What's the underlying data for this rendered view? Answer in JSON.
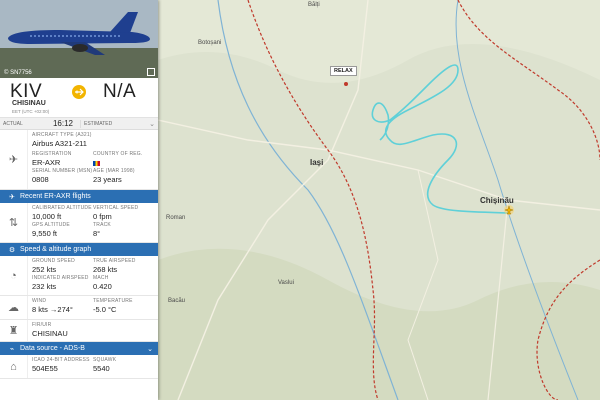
{
  "photo": {
    "credit": "© SN7756"
  },
  "route": {
    "from_code": "KIV",
    "to_code": "N/A",
    "from_city": "CHISINAU",
    "from_tz": "EET (UTC +02:00)"
  },
  "times": {
    "actual_label": "ACTUAL",
    "actual_value": "16:12",
    "estimated_label": "ESTIMATED"
  },
  "aircraft": {
    "type_label": "AIRCRAFT TYPE",
    "type_code": "(A321)",
    "type_value": "Airbus A321-211",
    "registration_label": "REGISTRATION",
    "registration_value": "ER-AXR",
    "country_label": "COUNTRY OF REG.",
    "serial_label": "SERIAL NUMBER (MSN)",
    "serial_value": "0808",
    "age_label": "AGE (MAR 1998)",
    "age_value": "23 years"
  },
  "recent_flights_bar": "Recent ER-AXR flights",
  "altitude": {
    "calibrated_label": "CALIBRATED ALTITUDE",
    "calibrated_value": "10,000 ft",
    "vspeed_label": "VERTICAL SPEED",
    "vspeed_value": "0 fpm",
    "gps_label": "GPS ALTITUDE",
    "gps_value": "9,550 ft",
    "track_label": "TRACK",
    "track_value": "8°"
  },
  "speed_bar": "Speed & altitude graph",
  "speed": {
    "ground_label": "GROUND SPEED",
    "ground_value": "252 kts",
    "true_label": "TRUE AIRSPEED",
    "true_value": "268 kts",
    "indicated_label": "INDICATED AIRSPEED",
    "indicated_value": "232 kts",
    "mach_label": "MACH",
    "mach_value": "0.420"
  },
  "weather": {
    "wind_label": "WIND",
    "wind_value": "8 kts →274°",
    "temp_label": "TEMPERATURE",
    "temp_value": "-5.0 °C"
  },
  "fir": {
    "label": "FIR/UIR",
    "value": "CHISINAU"
  },
  "source_bar": "Data source - ADS-B",
  "icao": {
    "address_label": "ICAO 24-BIT ADDRESS",
    "address_value": "504E55",
    "squawk_label": "SQUAWK",
    "squawk_value": "5540"
  },
  "map": {
    "relax_label": "RELAX",
    "cities": {
      "balti": "Bălți",
      "iasi": "Iași",
      "chisinau": "Chișinău",
      "roman": "Roman",
      "bacau": "Bacău",
      "botosani": "Botoșani",
      "vaslui": "Vaslui"
    },
    "track_color": "#5fd0d8",
    "border_color": "#c0392b"
  }
}
